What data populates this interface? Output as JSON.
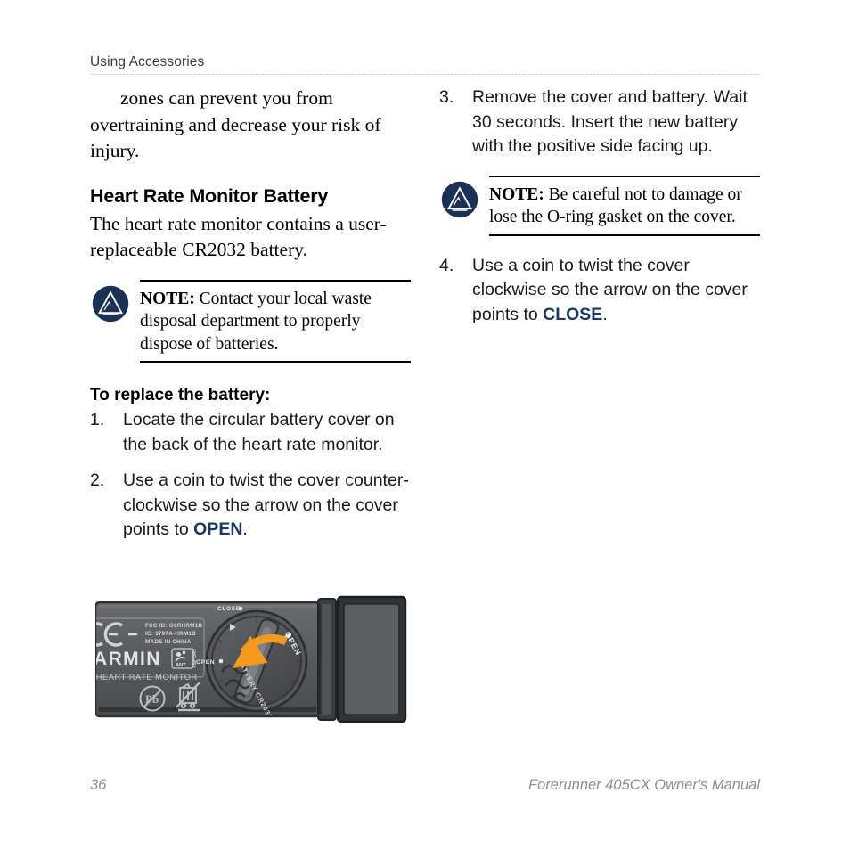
{
  "header": {
    "title": "Using Accessories"
  },
  "left_column": {
    "continued_paragraph": "zones can prevent you from overtraining and decrease your risk of injury.",
    "section_heading": "Heart Rate Monitor Battery",
    "section_paragraph": "The heart rate monitor contains a user-replaceable CR2032 battery.",
    "note": {
      "label": "NOTE:",
      "text": " Contact your local waste disposal department to properly dispose of batteries."
    },
    "sub_heading": "To replace the battery:",
    "steps": [
      {
        "num": "1.",
        "parts": [
          {
            "text": "Locate the circular battery cover on the back of the heart rate monitor.",
            "style": "normal"
          }
        ]
      },
      {
        "num": "2.",
        "parts": [
          {
            "text": "Use a coin to twist the cover counter-clockwise so the arrow on the cover points to ",
            "style": "normal"
          },
          {
            "text": "OPEN",
            "style": "keyword"
          },
          {
            "text": ".",
            "style": "normal"
          }
        ]
      }
    ]
  },
  "right_column": {
    "steps_top": [
      {
        "num": "3.",
        "parts": [
          {
            "text": "Remove the cover and battery. Wait 30 seconds. Insert the new battery with the positive side facing up.",
            "style": "normal"
          }
        ]
      }
    ],
    "note": {
      "label": "NOTE:",
      "text": " Be careful not to damage or lose the O-ring gasket on the cover."
    },
    "steps_bottom": [
      {
        "num": "4.",
        "parts": [
          {
            "text": "Use a coin to twist the cover clockwise so the arrow on the cover points to ",
            "style": "normal"
          },
          {
            "text": "CLOSE",
            "style": "keyword"
          },
          {
            "text": ".",
            "style": "normal"
          }
        ]
      }
    ]
  },
  "figure": {
    "caption_absent": true,
    "device_labels": {
      "brand": "ARMIN",
      "product_line": "- HEART RATE MONITOR",
      "ant_badge": "ANT",
      "ant_plus": "+SPORT",
      "regulatory_lines": [
        "FCC ID: O6RHRM1B",
        "IC: 3797A-HRM1B",
        "MADE IN CHINA"
      ],
      "ce_mark": "CE",
      "pb_mark": "Pb",
      "cover_close": "CLOSE",
      "cover_open": "OPEN",
      "cover_battery": "BATTERY CR2032"
    }
  },
  "footer": {
    "page_number": "36",
    "manual_title": "Forerunner 405CX Owner's Manual"
  },
  "colors": {
    "note_icon_navy": "#1b3055",
    "keyword_navy": "#1b3a63",
    "footer_gray": "#8e8e8e",
    "strap_gray": "#58595b",
    "arrow_orange": "#f59a1e"
  }
}
